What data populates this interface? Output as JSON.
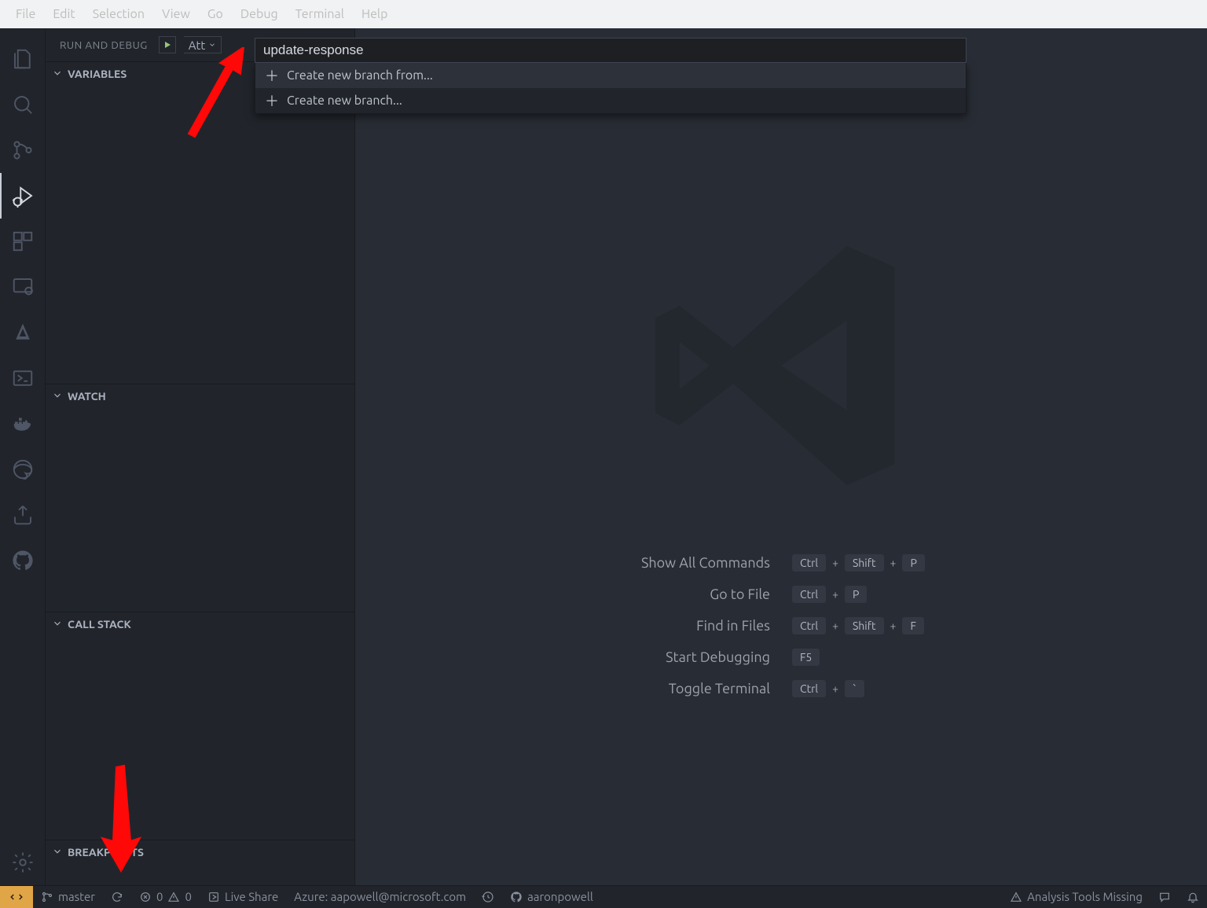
{
  "menubar": [
    "File",
    "Edit",
    "Selection",
    "View",
    "Go",
    "Debug",
    "Terminal",
    "Help"
  ],
  "sidebar": {
    "title": "RUN AND DEBUG",
    "config": "Att",
    "sections": {
      "variables": "VARIABLES",
      "watch": "WATCH",
      "callstack": "CALL STACK",
      "breakpoints": "BREAKPOINTS"
    }
  },
  "quickinput": {
    "value": "update-response",
    "items": [
      "Create new branch from...",
      "Create new branch..."
    ]
  },
  "welcome": {
    "rows": [
      {
        "label": "Show All Commands",
        "keys": [
          "Ctrl",
          "+",
          "Shift",
          "+",
          "P"
        ]
      },
      {
        "label": "Go to File",
        "keys": [
          "Ctrl",
          "+",
          "P"
        ]
      },
      {
        "label": "Find in Files",
        "keys": [
          "Ctrl",
          "+",
          "Shift",
          "+",
          "F"
        ]
      },
      {
        "label": "Start Debugging",
        "keys": [
          "F5"
        ]
      },
      {
        "label": "Toggle Terminal",
        "keys": [
          "Ctrl",
          "+",
          "`"
        ]
      }
    ]
  },
  "statusbar": {
    "branch": "master",
    "errors": "0",
    "warnings": "0",
    "liveshare": "Live Share",
    "azure": "Azure: aapowell@microsoft.com",
    "github": "aaronpowell",
    "analysis": "Analysis Tools Missing"
  }
}
